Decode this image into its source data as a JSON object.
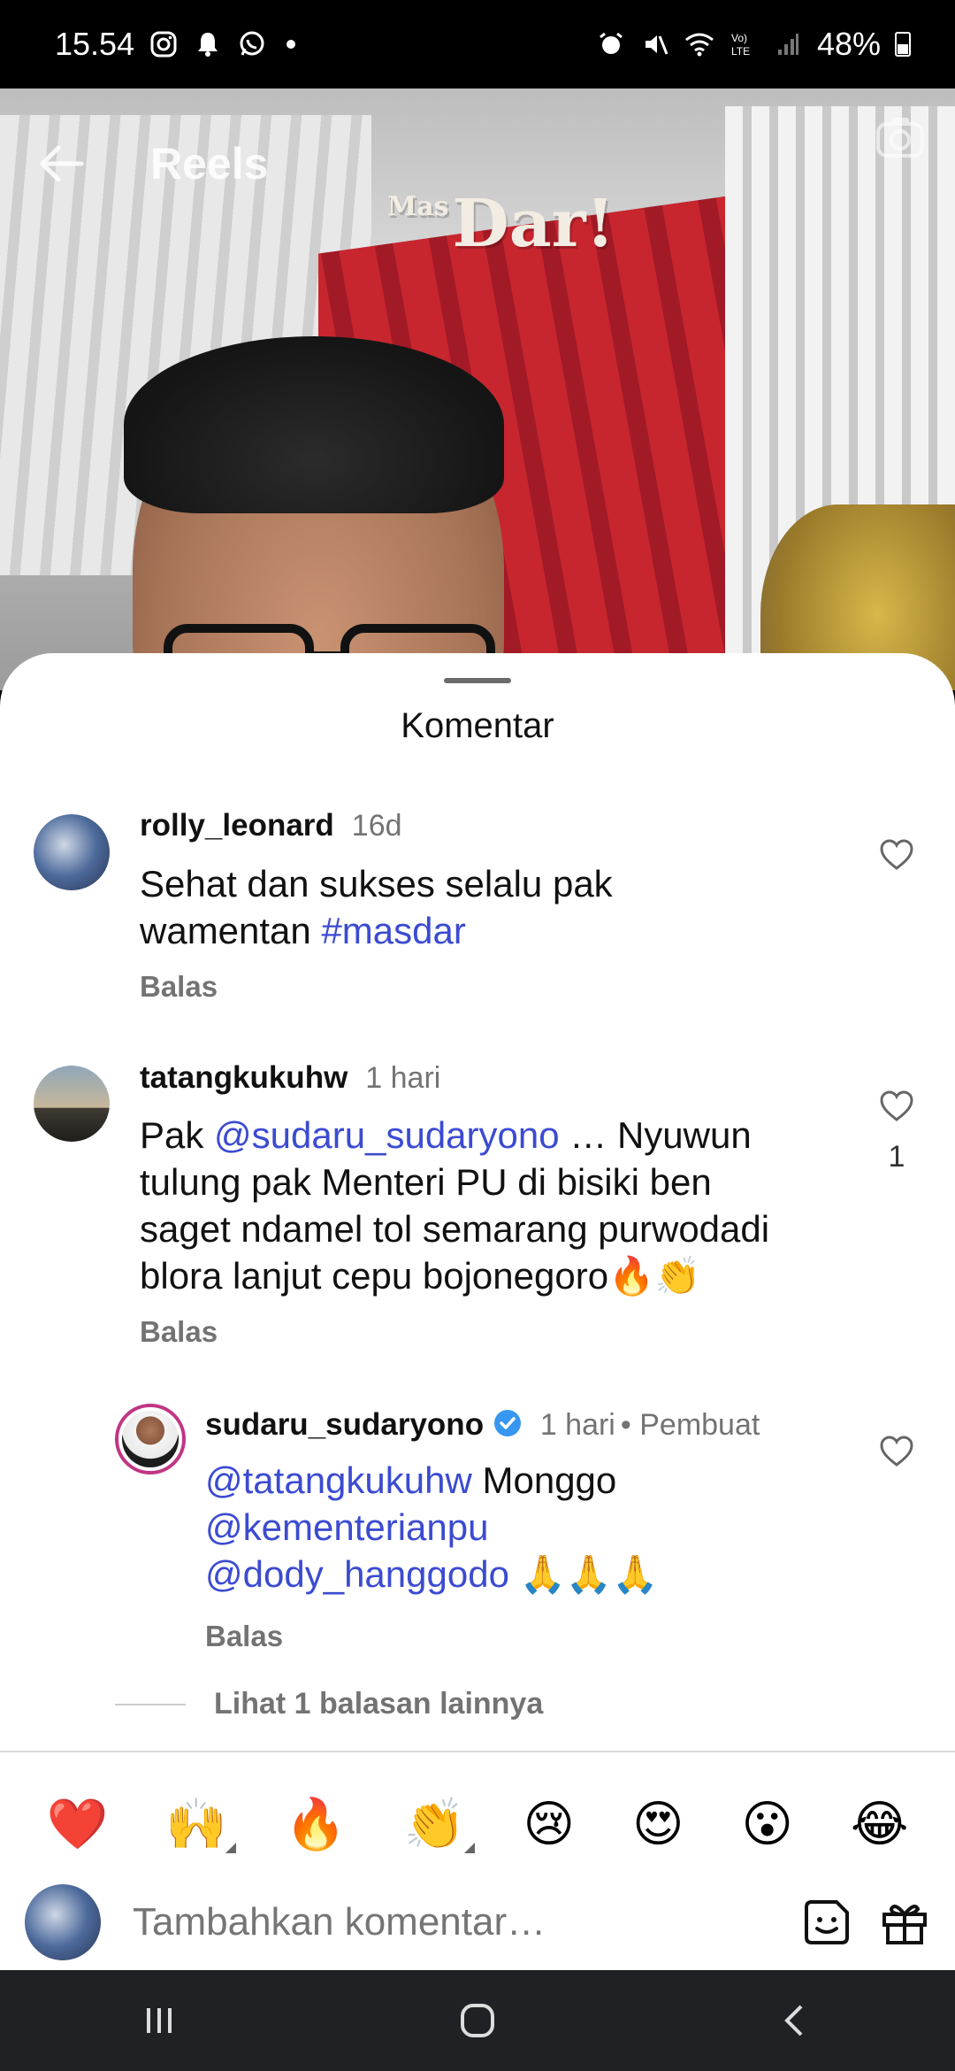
{
  "status_bar": {
    "time": "15.54",
    "battery": "48%",
    "icons_left": [
      "instagram-icon",
      "notification-bell-icon",
      "whatsapp-icon"
    ],
    "icons_right": [
      "alarm-icon",
      "mute-icon",
      "wifi-icon",
      "volte-icon",
      "signal-icon",
      "battery-icon"
    ]
  },
  "video": {
    "header_title": "Reels",
    "overlay_logo": "Dar!",
    "overlay_logo_small": "Mas"
  },
  "sheet": {
    "title": "Komentar"
  },
  "comments": [
    {
      "username": "rolly_leonard",
      "time": "16d",
      "text_line1": "Sehat dan sukses selalu pak",
      "text_line2_plain": "wamentan ",
      "text_line2_tag": "#masdar",
      "reply_label": "Balas"
    },
    {
      "username": "tatangkukuhw",
      "time": "1 hari",
      "line1_prefix": "Pak ",
      "line1_mention": "@sudaru_sudaryono",
      "line1_suffix": " … Nyuwun",
      "line2": "tulung pak Menteri PU di bisiki ben",
      "line3": "saget ndamel tol semarang purwodadi",
      "line4": "blora lanjut cepu bojonegoro🔥👏",
      "like_count": "1",
      "reply_label": "Balas"
    }
  ],
  "reply": {
    "username": "sudaru_sudaryono",
    "time": "1 hari",
    "creator_label": "Pembuat",
    "mention1": "@tatangkukuhw",
    "mention1_suffix": " Monggo",
    "mention2": "@kementerianpu",
    "mention3": "@dody_hanggodo",
    "mention3_suffix": " 🙏🙏🙏",
    "reply_label": "Balas"
  },
  "more_replies_label": "Lihat 1 balasan lainnya",
  "quick_emojis": [
    "❤️",
    "🙌",
    "🔥",
    "👏",
    "😢",
    "😍",
    "😮",
    "😂"
  ],
  "input": {
    "placeholder": "Tambahkan komentar…"
  }
}
